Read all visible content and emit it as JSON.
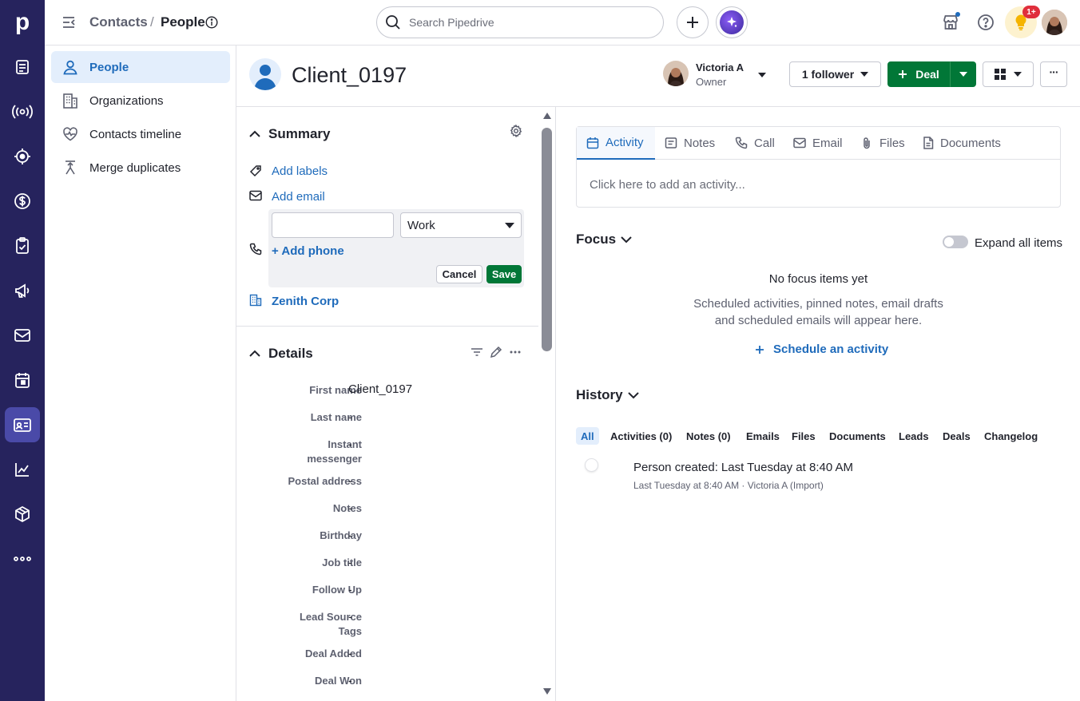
{
  "rail": {
    "logo": "p",
    "items": [
      {
        "icon": "leads-icon"
      },
      {
        "icon": "broadcast-icon"
      },
      {
        "icon": "target-icon"
      },
      {
        "icon": "dollar-icon"
      },
      {
        "icon": "clipboard-icon"
      },
      {
        "icon": "megaphone-icon"
      },
      {
        "icon": "mail-icon"
      },
      {
        "icon": "calendar-icon"
      },
      {
        "icon": "contacts-card-icon"
      },
      {
        "icon": "chart-icon"
      },
      {
        "icon": "box-icon"
      },
      {
        "icon": "more-icon"
      }
    ]
  },
  "topbar": {
    "crumb_contacts": "Contacts",
    "crumb_sep": "/",
    "crumb_people": "People",
    "search_placeholder": "Search Pipedrive",
    "notification_badge": "1+"
  },
  "leftmenu": {
    "items": [
      {
        "label": "People"
      },
      {
        "label": "Organizations"
      },
      {
        "label": "Contacts timeline"
      },
      {
        "label": "Merge duplicates"
      }
    ]
  },
  "header": {
    "person_name": "Client_0197",
    "owner_name": "Victoria A",
    "owner_role": "Owner",
    "follower_label": "1 follower",
    "deal_label": "Deal",
    "more_label": "···"
  },
  "summary": {
    "title": "Summary",
    "add_labels": "Add labels",
    "add_email": "Add email",
    "email_value": "",
    "email_type": "Work",
    "add_phone": "+ Add phone",
    "cancel_label": "Cancel",
    "save_label": "Save",
    "organization": "Zenith Corp"
  },
  "details": {
    "title": "Details",
    "fields": [
      {
        "label": "First name",
        "value": "Client_0197"
      },
      {
        "label": "Last name",
        "value": "-"
      },
      {
        "label": "Instant messenger",
        "value": "-"
      },
      {
        "label": "Postal address",
        "value": "-"
      },
      {
        "label": "Notes",
        "value": "-"
      },
      {
        "label": "Birthday",
        "value": "-"
      },
      {
        "label": "Job title",
        "value": "-"
      },
      {
        "label": "Follow Up",
        "value": "-"
      },
      {
        "label": "Lead Source Tags",
        "value": "-"
      },
      {
        "label": "Deal Added",
        "value": "-"
      },
      {
        "label": "Deal Won",
        "value": "-"
      }
    ]
  },
  "composer": {
    "tabs": [
      {
        "label": "Activity"
      },
      {
        "label": "Notes"
      },
      {
        "label": "Call"
      },
      {
        "label": "Email"
      },
      {
        "label": "Files"
      },
      {
        "label": "Documents"
      }
    ],
    "placeholder": "Click here to add an activity..."
  },
  "focus": {
    "title": "Focus",
    "expand_label": "Expand all items",
    "empty_title": "No focus items yet",
    "empty_line1": "Scheduled activities, pinned notes, email drafts",
    "empty_line2": "and scheduled emails will appear here.",
    "schedule_label": "Schedule an activity"
  },
  "history": {
    "title": "History",
    "tabs": [
      {
        "label": "All"
      },
      {
        "label": "Activities (0)"
      },
      {
        "label": "Notes (0)"
      },
      {
        "label": "Emails"
      },
      {
        "label": "Files"
      },
      {
        "label": "Documents"
      },
      {
        "label": "Leads"
      },
      {
        "label": "Deals"
      },
      {
        "label": "Changelog"
      }
    ],
    "entry_title": "Person created",
    "entry_sep": ":",
    "entry_when": "Last Tuesday at 8:40 AM",
    "entry_meta": "Last Tuesday at 8:40 AM · Victoria A (Import)"
  }
}
